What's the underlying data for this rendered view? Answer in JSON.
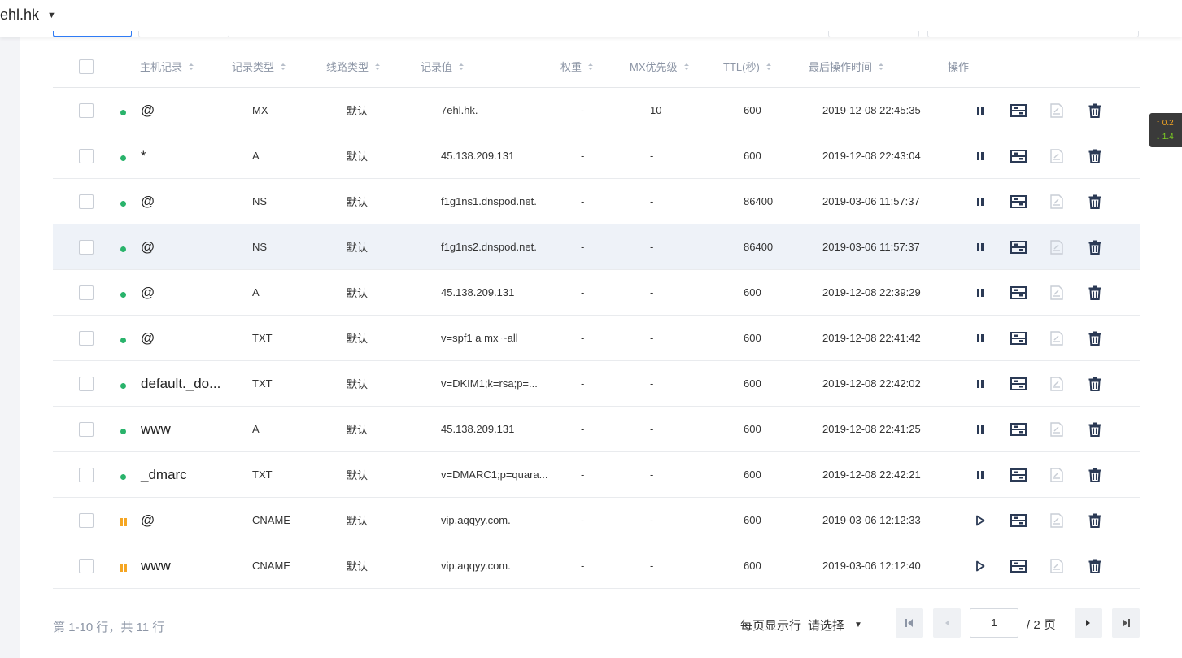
{
  "header": {
    "domain": "ehl.hk"
  },
  "columns": [
    "主机记录",
    "记录类型",
    "线路类型",
    "记录值",
    "权重",
    "MX优先级",
    "TTL(秒)",
    "最后操作时间",
    "操作"
  ],
  "rows": [
    {
      "status": "active",
      "host": "@",
      "type": "MX",
      "line": "默认",
      "value": "7ehl.hk.",
      "weight": "-",
      "mx": "10",
      "ttl": "600",
      "time": "2019-12-08 22:45:35"
    },
    {
      "status": "active",
      "host": "*",
      "type": "A",
      "line": "默认",
      "value": "45.138.209.131",
      "weight": "-",
      "mx": "-",
      "ttl": "600",
      "time": "2019-12-08 22:43:04"
    },
    {
      "status": "active",
      "host": "@",
      "type": "NS",
      "line": "默认",
      "value": "f1g1ns1.dnspod.net.",
      "weight": "-",
      "mx": "-",
      "ttl": "86400",
      "time": "2019-03-06 11:57:37"
    },
    {
      "status": "active",
      "host": "@",
      "type": "NS",
      "line": "默认",
      "value": "f1g1ns2.dnspod.net.",
      "weight": "-",
      "mx": "-",
      "ttl": "86400",
      "time": "2019-03-06 11:57:37"
    },
    {
      "status": "active",
      "host": "@",
      "type": "A",
      "line": "默认",
      "value": "45.138.209.131",
      "weight": "-",
      "mx": "-",
      "ttl": "600",
      "time": "2019-12-08 22:39:29"
    },
    {
      "status": "active",
      "host": "@",
      "type": "TXT",
      "line": "默认",
      "value": "v=spf1 a mx ~all",
      "weight": "-",
      "mx": "-",
      "ttl": "600",
      "time": "2019-12-08 22:41:42"
    },
    {
      "status": "active",
      "host": "default._do...",
      "type": "TXT",
      "line": "默认",
      "value": "v=DKIM1;k=rsa;p=...",
      "weight": "-",
      "mx": "-",
      "ttl": "600",
      "time": "2019-12-08 22:42:02"
    },
    {
      "status": "active",
      "host": "www",
      "type": "A",
      "line": "默认",
      "value": "45.138.209.131",
      "weight": "-",
      "mx": "-",
      "ttl": "600",
      "time": "2019-12-08 22:41:25"
    },
    {
      "status": "active",
      "host": "_dmarc",
      "type": "TXT",
      "line": "默认",
      "value": "v=DMARC1;p=quara...",
      "weight": "-",
      "mx": "-",
      "ttl": "600",
      "time": "2019-12-08 22:42:21"
    },
    {
      "status": "paused",
      "host": "@",
      "type": "CNAME",
      "line": "默认",
      "value": "vip.aqqyy.com.",
      "weight": "-",
      "mx": "-",
      "ttl": "600",
      "time": "2019-03-06 12:12:33"
    },
    {
      "status": "paused",
      "host": "www",
      "type": "CNAME",
      "line": "默认",
      "value": "vip.aqqyy.com.",
      "weight": "-",
      "mx": "-",
      "ttl": "600",
      "time": "2019-03-06 12:12:40"
    }
  ],
  "footer": {
    "summary": "第 1-10 行，共 11 行",
    "per_page_label": "每页显示行",
    "per_page_value": "请选择",
    "page_current": "1",
    "page_total": "/ 2 页"
  },
  "side_widget": {
    "up": "↑ 0.2",
    "down": "↓ 1.4"
  },
  "colors": {
    "active": "#29b36b",
    "paused": "#f5a623",
    "accent": "#2f7bf5"
  }
}
